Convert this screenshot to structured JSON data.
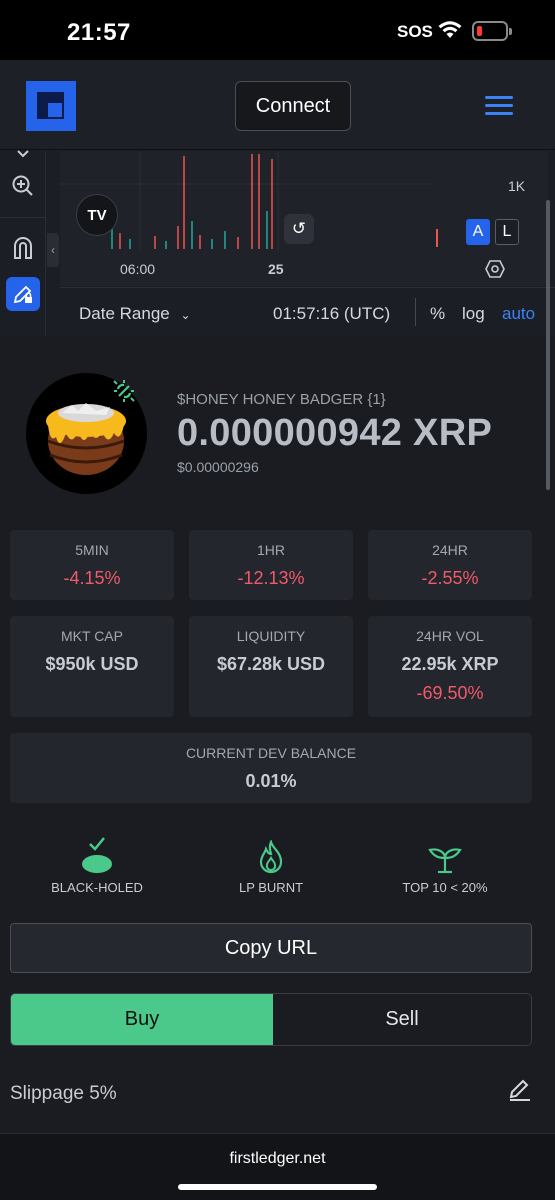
{
  "status_bar": {
    "time": "21:57",
    "sos": "SOS"
  },
  "header": {
    "connect_label": "Connect"
  },
  "chart": {
    "y_label": "1K",
    "x_labels": [
      "06:00",
      "25"
    ],
    "tv_logo": "TV",
    "scale_a": "A",
    "scale_l": "L",
    "date_range_label": "Date Range",
    "utc_time": "01:57:16 (UTC)",
    "pct_label": "%",
    "log_label": "log",
    "auto_label": "auto"
  },
  "token": {
    "name": "$HONEY HONEY BADGER {1}",
    "price": "0.000000942 XRP",
    "usd_price": "$0.00000296"
  },
  "stats": {
    "m5_label": "5MIN",
    "m5_value": "-4.15%",
    "h1_label": "1HR",
    "h1_value": "-12.13%",
    "h24_label": "24HR",
    "h24_value": "-2.55%",
    "mcap_label": "MKT CAP",
    "mcap_value": "$950k USD",
    "liq_label": "LIQUIDITY",
    "liq_value": "$67.28k USD",
    "vol_label": "24HR VOL",
    "vol_value": "22.95k XRP",
    "vol_change": "-69.50%",
    "dev_label": "CURRENT DEV BALANCE",
    "dev_value": "0.01%"
  },
  "badges": {
    "black_holed": "BLACK-HOLED",
    "lp_burnt": "LP BURNT",
    "top10": "TOP 10 < 20%"
  },
  "actions": {
    "copy_url": "Copy URL",
    "buy": "Buy",
    "sell": "Sell",
    "slippage": "Slippage 5%"
  },
  "browser": {
    "url": "firstledger.net"
  },
  "colors": {
    "accent": "#2563eb",
    "buy": "#4ac98a",
    "negative": "#f05a6a",
    "link": "#3b82f6"
  }
}
